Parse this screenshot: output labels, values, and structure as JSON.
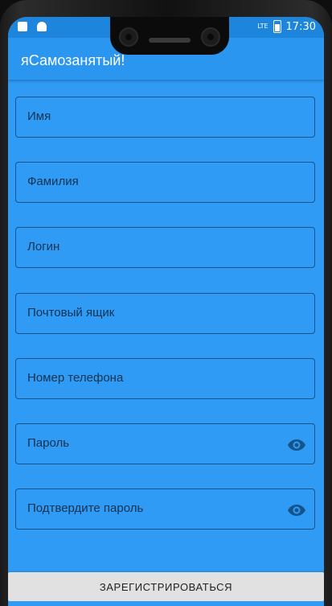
{
  "status_bar": {
    "time": "17:30",
    "network": "LTE",
    "notification_icons": [
      "sd-card-icon",
      "android-icon"
    ]
  },
  "app_bar": {
    "title": "яСамозанятый!"
  },
  "form": {
    "fields": [
      {
        "label": "Имя",
        "has_visibility_toggle": false
      },
      {
        "label": "Фамилия",
        "has_visibility_toggle": false
      },
      {
        "label": "Логин",
        "has_visibility_toggle": false
      },
      {
        "label": "Почтовый ящик",
        "has_visibility_toggle": false
      },
      {
        "label": "Номер телефона",
        "has_visibility_toggle": false
      },
      {
        "label": "Пароль",
        "has_visibility_toggle": true,
        "toggle_icon": "eye-icon"
      },
      {
        "label": "Подтвердите пароль",
        "has_visibility_toggle": true,
        "toggle_icon": "eye-icon"
      }
    ]
  },
  "actions": {
    "register_label": "ЗАРЕГИСТРИРОВАТЬСЯ"
  },
  "colors": {
    "background": "#2f9bf5",
    "app_bar": "#2b96f0",
    "field_border": "#14548a",
    "button": "#e1e1e1"
  }
}
